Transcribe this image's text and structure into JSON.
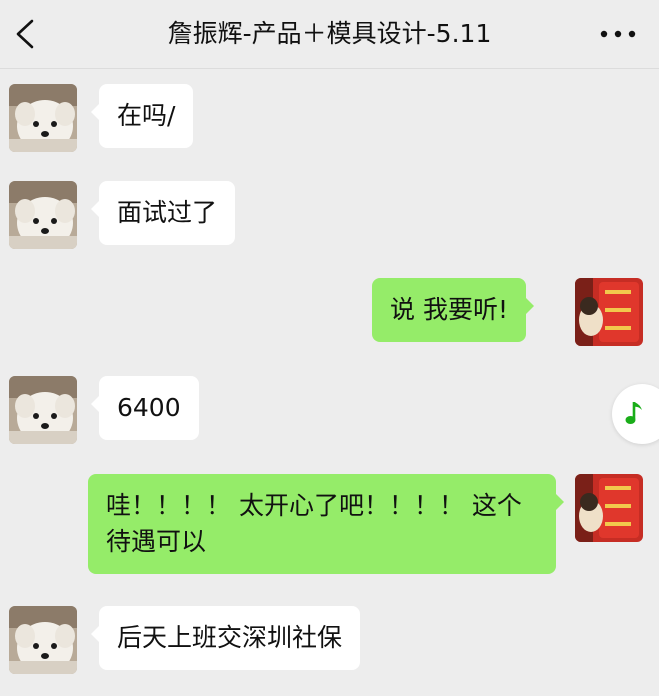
{
  "header": {
    "title": "詹振辉-产品＋模具设计-5.11",
    "back_icon": "chevron-left-icon",
    "more_icon": "more-dots-icon"
  },
  "messages": [
    {
      "side": "left",
      "text": "在吗/"
    },
    {
      "side": "left",
      "text": "面试过了"
    },
    {
      "side": "right",
      "text": "说 我要听!"
    },
    {
      "side": "left",
      "text": "6400"
    },
    {
      "side": "right",
      "text": "哇！！！！ 太开心了吧！！！！ 这个待遇可以"
    },
    {
      "side": "left",
      "text": "后天上班交深圳社保"
    }
  ],
  "floating": {
    "icon": "music-note-icon"
  },
  "colors": {
    "background": "#ededed",
    "incoming_bubble": "#ffffff",
    "outgoing_bubble": "#95ec69",
    "music_accent": "#1aad19"
  }
}
